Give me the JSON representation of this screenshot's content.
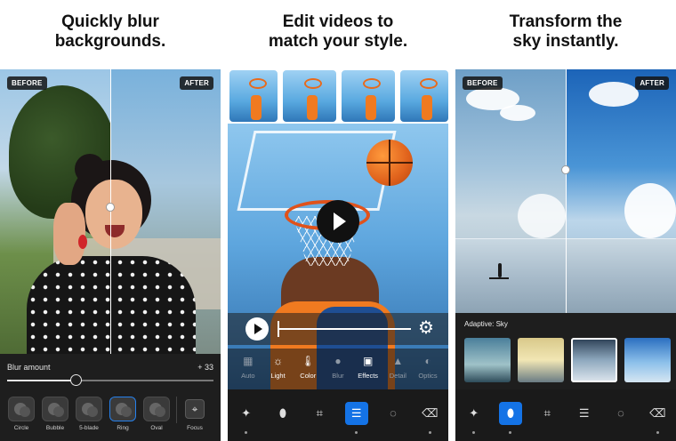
{
  "panels": [
    {
      "headline_line1": "Quickly blur",
      "headline_line2": "backgrounds.",
      "before_label": "BEFORE",
      "after_label": "AFTER",
      "blur_amount_label": "Blur amount",
      "blur_amount_value": "+ 33",
      "blur_amount_fraction": 0.33,
      "bokeh_options": [
        {
          "label": "Circle",
          "selected": false
        },
        {
          "label": "Bubble",
          "selected": false
        },
        {
          "label": "5-blade",
          "selected": false
        },
        {
          "label": "Ring",
          "selected": true
        },
        {
          "label": "Oval",
          "selected": false
        }
      ],
      "focus_label": "Focus",
      "focus_icon": "focus-frame-icon"
    },
    {
      "headline_line1": "Edit videos to",
      "headline_line2": "match your style.",
      "tools": [
        {
          "label": "Auto",
          "icon": "auto-icon",
          "dim": true
        },
        {
          "label": "Light",
          "icon": "sun-icon",
          "dim": false
        },
        {
          "label": "Color",
          "icon": "thermometer-icon",
          "dim": false
        },
        {
          "label": "Blur",
          "icon": "drop-icon",
          "dim": true
        },
        {
          "label": "Effects",
          "icon": "effects-icon",
          "dim": false
        },
        {
          "label": "Detail",
          "icon": "triangle-icon",
          "dim": true
        },
        {
          "label": "Optics",
          "icon": "lens-icon",
          "dim": true
        }
      ],
      "settings_icon": "gear-icon"
    },
    {
      "headline_line1": "Transform the",
      "headline_line2": "sky instantly.",
      "before_label": "BEFORE",
      "after_label": "AFTER",
      "adaptive_label": "Adaptive: Sky",
      "selected_preset_index": 2
    }
  ],
  "bottom_toolbar_icons": [
    "magic-wand-icon",
    "eraser-pill-icon",
    "crop-icon",
    "sliders-icon",
    "radial-icon",
    "eraser-icon"
  ],
  "colors": {
    "accent_blue": "#1473e6",
    "dark_ui": "#1e1e1e"
  }
}
